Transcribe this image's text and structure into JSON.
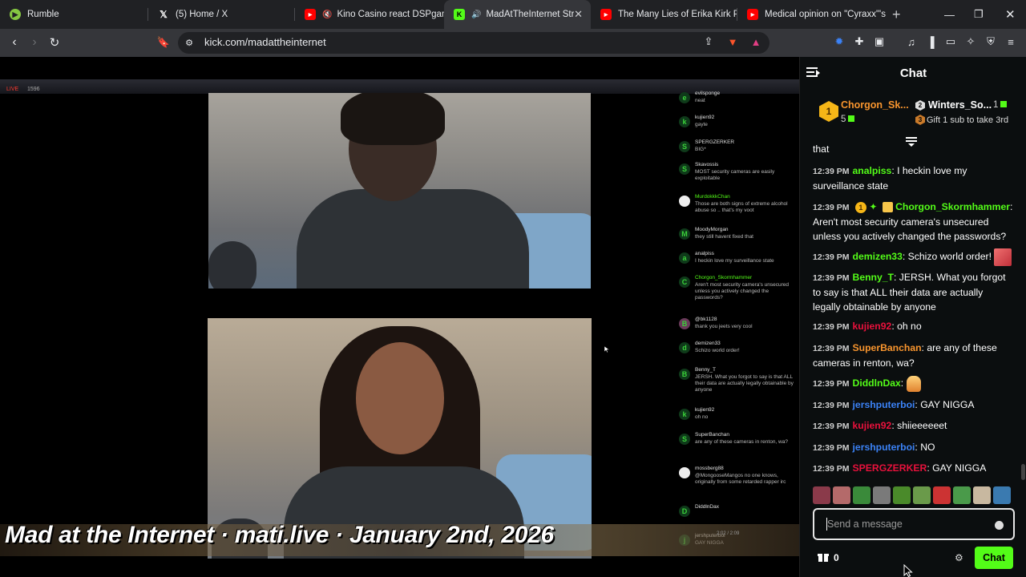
{
  "browser": {
    "tabs": [
      {
        "label": "Rumble",
        "icon": "rumble-icon",
        "color": "#85c742"
      },
      {
        "label": "(5) Home / X",
        "icon": "x-logo-icon",
        "color": "#ffffff"
      },
      {
        "label": "Kino Casino react DSPgaming",
        "icon": "youtube-icon",
        "color": "#ff0000"
      },
      {
        "label": "MadAtTheInternet Stream",
        "icon": "kick-icon",
        "color": "#53fc18"
      },
      {
        "label": "The Many Lies of Erika Kirk Pt.1",
        "icon": "youtube-icon",
        "color": "#ff0000"
      },
      {
        "label": "Medical opinion on \"Cyraxx\"'s m",
        "icon": "youtube-icon",
        "color": "#ff0000"
      }
    ],
    "url": "kick.com/madattheinternet",
    "brave_badge": "4"
  },
  "video": {
    "live_label": "LIVE",
    "viewer_count": "1596",
    "caption": "Mad at the Internet · mati.live · January 2nd, 2026",
    "timecode": "2:02 / 2:09"
  },
  "video_chat": [
    {
      "user": "evilsponge",
      "text": "neat",
      "initial": "e"
    },
    {
      "user": "kujien92",
      "text": "gayte",
      "initial": "k"
    },
    {
      "user": "SPERGZERKER",
      "text": "BIG*",
      "initial": "S"
    },
    {
      "user": "Skavossis",
      "text": "MOST security cameras are easily exploitable",
      "initial": "S"
    },
    {
      "user": "MurdokkkChan",
      "text": "Those are both signs of extreme alcohol abuse so .. that's my voot",
      "initial": ""
    },
    {
      "user": "MoodyMorgan",
      "text": "they still havent fixed that",
      "initial": "M"
    },
    {
      "user": "analpiss",
      "text": "I heckin love my surveillance state",
      "initial": "a"
    },
    {
      "user": "Chorgon_Skormhammer",
      "text": "Aren't most security camera's unsecured unless you actively changed the passwords?",
      "initial": "C"
    },
    {
      "user": "@bk1128",
      "text": "thank you jeets very cool",
      "initial": "B"
    },
    {
      "user": "demizen33",
      "text": "Schizo world order!",
      "initial": "d"
    },
    {
      "user": "Benny_T",
      "text": "JERSH. What you forgot to say is that ALL their data are actually legally obtainable by anyone",
      "initial": "B"
    },
    {
      "user": "kujien92",
      "text": "oh no",
      "initial": "k"
    },
    {
      "user": "SuperBanchan",
      "text": "are any of these cameras in renton, wa?",
      "initial": "S"
    },
    {
      "user": "mossberg88",
      "text": "@MongooseMangos no one knows, originally from some retarded rapper irc",
      "initial": ""
    },
    {
      "user": "DiddlnDax",
      "text": "",
      "initial": "D"
    },
    {
      "user": "jershputerboi",
      "text": "GAY NIGGA",
      "initial": "j"
    }
  ],
  "chat": {
    "title": "Chat",
    "gifters": {
      "first": {
        "rank": "1",
        "name": "Chorgon_Sk...",
        "count": "5"
      },
      "second": {
        "name": "Winters_So...",
        "count": "1"
      },
      "hint": "Gift 1 sub to take 3rd"
    },
    "messages": [
      {
        "time": "",
        "user": "",
        "text": "that",
        "color": "#ffffff"
      },
      {
        "time": "12:39 PM",
        "user": "analpiss",
        "text": "I heckin love my surveillance state",
        "color": "#53fc18"
      },
      {
        "time": "12:39 PM",
        "user": "Chorgon_Skormhammer",
        "text": "Aren't most security camera's unsecured unless you actively changed the passwords?",
        "color": "#53fc18"
      },
      {
        "time": "12:39 PM",
        "user": "demizen33",
        "text": "Schizo world order!",
        "color": "#53fc18"
      },
      {
        "time": "12:39 PM",
        "user": "Benny_T",
        "text": "JERSH. What you forgot to say is that ALL their data are actually legally obtainable by anyone",
        "color": "#53fc18"
      },
      {
        "time": "12:39 PM",
        "user": "kujien92",
        "text": "oh no",
        "color": "#e9113c"
      },
      {
        "time": "12:39 PM",
        "user": "SuperBanchan",
        "text": "are any of these cameras in renton, wa?",
        "color": "#f8952e"
      },
      {
        "time": "12:39 PM",
        "user": "DiddlnDax",
        "text": "",
        "color": "#53fc18"
      },
      {
        "time": "12:39 PM",
        "user": "jershputerboi",
        "text": "GAY NIGGA",
        "color": "#3b82f6"
      },
      {
        "time": "12:39 PM",
        "user": "kujien92",
        "text": "shiieeeeeet",
        "color": "#e9113c"
      },
      {
        "time": "12:39 PM",
        "user": "jershputerboi",
        "text": "NO",
        "color": "#3b82f6"
      },
      {
        "time": "12:39 PM",
        "user": "SPERGZERKER",
        "text": "GAY NIGGA",
        "color": "#e9113c"
      }
    ],
    "input_placeholder": "Send a message",
    "points": "0",
    "send_label": "Chat"
  }
}
